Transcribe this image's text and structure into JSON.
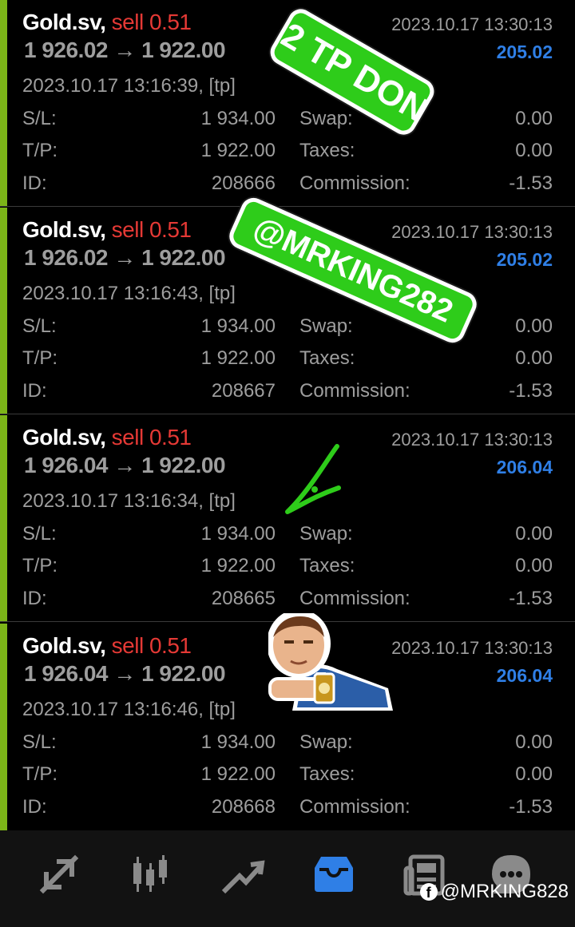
{
  "trades": [
    {
      "symbol": "Gold.sv,",
      "side": "sell 0.51",
      "open_price": "1 926.02",
      "close_price": "1 922.00",
      "close_time": "2023.10.17 13:30:13",
      "profit": "205.02",
      "open_time": "2023.10.17 13:16:39, [tp]",
      "sl_label": "S/L:",
      "sl": "1 934.00",
      "tp_label": "T/P:",
      "tp": "1 922.00",
      "id_label": "ID:",
      "id": "208666",
      "swap_label": "Swap:",
      "swap": "0.00",
      "taxes_label": "Taxes:",
      "taxes": "0.00",
      "commission_label": "Commission:",
      "commission": "-1.53"
    },
    {
      "symbol": "Gold.sv,",
      "side": "sell 0.51",
      "open_price": "1 926.02",
      "close_price": "1 922.00",
      "close_time": "2023.10.17 13:30:13",
      "profit": "205.02",
      "open_time": "2023.10.17 13:16:43, [tp]",
      "sl_label": "S/L:",
      "sl": "1 934.00",
      "tp_label": "T/P:",
      "tp": "1 922.00",
      "id_label": "ID:",
      "id": "208667",
      "swap_label": "Swap:",
      "swap": "0.00",
      "taxes_label": "Taxes:",
      "taxes": "0.00",
      "commission_label": "Commission:",
      "commission": "-1.53"
    },
    {
      "symbol": "Gold.sv,",
      "side": "sell 0.51",
      "open_price": "1 926.04",
      "close_price": "1 922.00",
      "close_time": "2023.10.17 13:30:13",
      "profit": "206.04",
      "open_time": "2023.10.17 13:16:34, [tp]",
      "sl_label": "S/L:",
      "sl": "1 934.00",
      "tp_label": "T/P:",
      "tp": "1 922.00",
      "id_label": "ID:",
      "id": "208665",
      "swap_label": "Swap:",
      "swap": "0.00",
      "taxes_label": "Taxes:",
      "taxes": "0.00",
      "commission_label": "Commission:",
      "commission": "-1.53"
    },
    {
      "symbol": "Gold.sv,",
      "side": "sell 0.51",
      "open_price": "1 926.04",
      "close_price": "1 922.00",
      "close_time": "2023.10.17 13:30:13",
      "profit": "206.04",
      "open_time": "2023.10.17 13:16:46, [tp]",
      "sl_label": "S/L:",
      "sl": "1 934.00",
      "tp_label": "T/P:",
      "tp": "1 922.00",
      "id_label": "ID:",
      "id": "208668",
      "swap_label": "Swap:",
      "swap": "0.00",
      "taxes_label": "Taxes:",
      "taxes": "0.00",
      "commission_label": "Commission:",
      "commission": "-1.53"
    }
  ],
  "arrow_glyph": "→",
  "overlays": {
    "stamp1": "2 TP DON",
    "stamp2": "@MRKING282"
  },
  "watermark": {
    "handle": "@MRKING828",
    "icon": "f"
  },
  "nav": [
    {
      "name": "quotes",
      "icon": "quotes-arrows-icon"
    },
    {
      "name": "chart",
      "icon": "candlestick-chart-icon"
    },
    {
      "name": "trade",
      "icon": "trade-trend-icon"
    },
    {
      "name": "history",
      "icon": "inbox-history-icon",
      "active": true
    },
    {
      "name": "news",
      "icon": "newspaper-icon"
    },
    {
      "name": "messages",
      "icon": "chat-bubble-icon"
    }
  ],
  "colors": {
    "accent_bar": "#7cb518",
    "sell": "#e53935",
    "profit": "#2f7fe6",
    "muted": "#9e9e9e",
    "active_nav": "#2f7fe6",
    "stamp": "#2ecc1a"
  }
}
